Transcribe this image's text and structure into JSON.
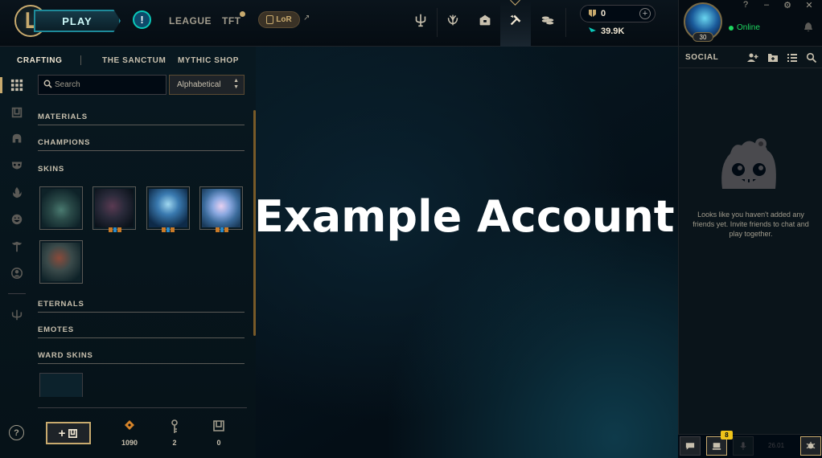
{
  "topbar": {
    "play_label": "PLAY",
    "alert_label": "!",
    "nav": [
      {
        "label": "LEAGUE"
      },
      {
        "label": "TFT"
      }
    ],
    "lor_label": "LoR",
    "lor_arrow": "↗",
    "blue_essence": "0",
    "riot_points": "39.9K",
    "plus_label": "+"
  },
  "profile": {
    "level": "30",
    "status": "Online"
  },
  "window_controls": {
    "help": "?",
    "minimize": "–",
    "settings": "⚙",
    "close": "✕"
  },
  "subnav": {
    "items": [
      {
        "label": "CRAFTING"
      },
      {
        "label": "THE SANCTUM"
      },
      {
        "label": "MYTHIC SHOP"
      }
    ]
  },
  "search": {
    "placeholder": "Search"
  },
  "sort": {
    "selected": "Alphabetical"
  },
  "categories": {
    "materials": "MATERIALS",
    "champions": "CHAMPIONS",
    "skins": "SKINS",
    "eternals": "ETERNALS",
    "emotes": "EMOTES",
    "ward_skins": "WARD SKINS"
  },
  "bottom": {
    "help_label": "?",
    "add_label": "+",
    "loot_counts": {
      "orange_essence": "1090",
      "keys": "2",
      "chests": "0"
    }
  },
  "watermark": "Example Account",
  "social": {
    "title": "SOCIAL",
    "empty_message": "Looks like you haven't added any friends yet. Invite friends to chat and play together.",
    "notification_count": "8",
    "version": "26.01"
  },
  "colors": {
    "gold": "#c8aa6e",
    "online": "#1ed760",
    "accent_teal": "#0ac8b9"
  }
}
